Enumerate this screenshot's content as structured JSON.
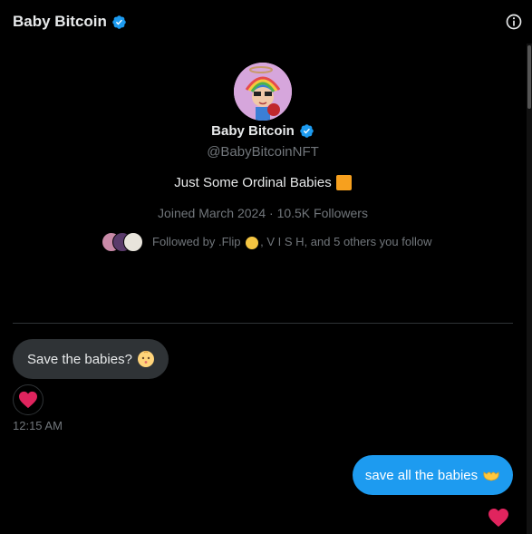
{
  "header": {
    "title": "Baby Bitcoin",
    "verified_icon": "verified-badge-icon",
    "info_icon": "info-icon"
  },
  "profile": {
    "name": "Baby Bitcoin",
    "handle": "@BabyBitcoinNFT",
    "bio": "Just Some Ordinal Babies",
    "bio_emoji": "orange-square",
    "meta": "Joined March 2024 · 10.5K Followers",
    "followed_prefix": "Followed by .Flip",
    "followed_suffix": ", V I S H, and 5 others you follow"
  },
  "messages": [
    {
      "direction": "incoming",
      "text": "Save the babies?",
      "emoji": "baby-face",
      "reaction": "heart",
      "time": "12:15 AM"
    },
    {
      "direction": "outgoing",
      "text": "save all the babies",
      "emoji": "heart-hands",
      "reaction": "heart"
    }
  ],
  "colors": {
    "accent": "#1d9bf0",
    "bubble_in": "#2f3336",
    "heart": "#f91880"
  }
}
